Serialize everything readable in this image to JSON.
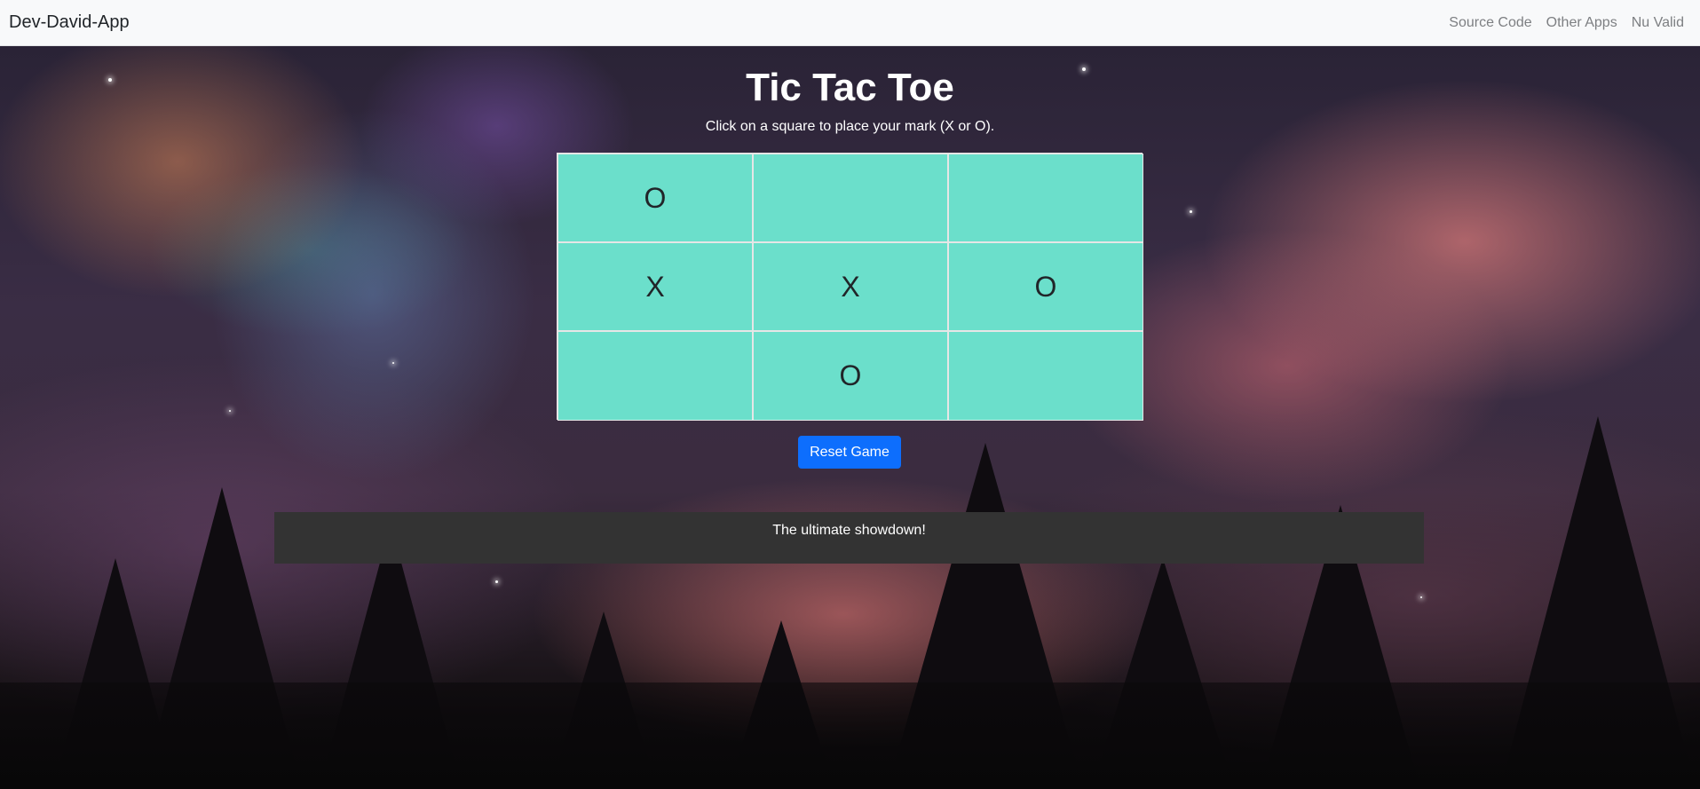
{
  "navbar": {
    "brand": "Dev-David-App",
    "links": [
      "Source Code",
      "Other Apps",
      "Nu Valid"
    ]
  },
  "game": {
    "title": "Tic Tac Toe",
    "instructions": "Click on a square to place your mark (X or O).",
    "board": [
      "O",
      "",
      "",
      "X",
      "X",
      "O",
      "",
      "O",
      ""
    ],
    "reset_label": "Reset Game",
    "cell_color": "#6bdfcb"
  },
  "footer": {
    "text": "The ultimate showdown!"
  },
  "colors": {
    "primary_button": "#0d6efd",
    "footer_bg": "#333333",
    "navbar_bg": "#f8f9fa"
  }
}
